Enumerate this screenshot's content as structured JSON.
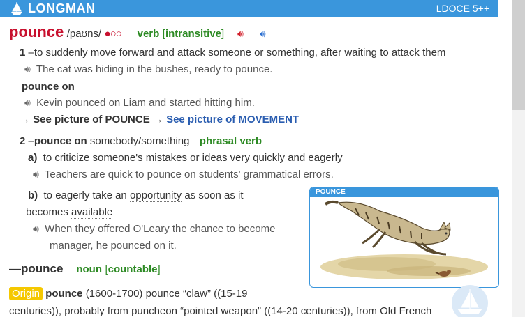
{
  "header": {
    "brand": "LONGMAN",
    "edition": "LDOCE 5++"
  },
  "entry": {
    "headword": "pounce",
    "pronunciation": "/paʊns/",
    "frequency": "●○○",
    "pos": "verb",
    "grammar": "intransitive"
  },
  "sense1": {
    "number": "1",
    "dash": "–",
    "definition_parts": [
      "to suddenly move ",
      "forward",
      " and ",
      "attack",
      " someone or something, after ",
      "waiting",
      " to attack them"
    ],
    "example": "The cat was hiding in the bushes, ready to pounce.",
    "phrase": "pounce on",
    "phrase_example": "Kevin pounced on Liam and started hitting him."
  },
  "see_pictures": {
    "arrow": "→",
    "label1": "See picture of POUNCE",
    "label2": "See picture of MOVEMENT"
  },
  "sense2": {
    "number": "2",
    "dash": "–",
    "phrase": "pounce on",
    "object": "somebody/something",
    "pos": "phrasal verb",
    "a": {
      "letter": "a)",
      "definition_parts": [
        "to ",
        "criticize",
        " someone's ",
        "mistakes",
        " or ideas very quickly and eagerly"
      ],
      "example": "Teachers are quick to pounce on students' grammatical errors."
    },
    "b": {
      "letter": "b)",
      "def_line1_parts": [
        "to eagerly take an ",
        "opportunity",
        " as soon as it"
      ],
      "def_line2_parts": [
        "becomes ",
        "available"
      ],
      "example_line1": "When they offered O'Leary the chance to become",
      "example_line2": "manager, he pounced on it."
    }
  },
  "noun": {
    "dash": "—",
    "headword": "pounce",
    "pos": "noun",
    "grammar": "countable"
  },
  "picture": {
    "label": "POUNCE"
  },
  "origin": {
    "badge": "Origin",
    "word": "pounce",
    "line1_rest": " (1600-1700) pounce “claw” ((15-19",
    "line2": "centuries)), probably from puncheon “pointed weapon” ((14-20 centuries)), from Old French"
  },
  "colors": {
    "brand": "#3a96dc",
    "headword": "#c8102e",
    "pos": "#2d8a24",
    "link": "#2a5db0",
    "origin": "#f5c800"
  }
}
